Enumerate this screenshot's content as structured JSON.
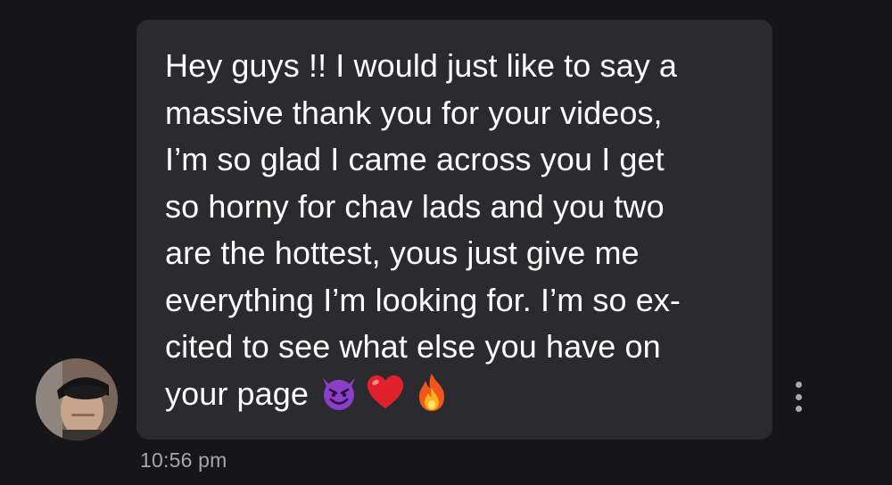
{
  "message": {
    "sender_avatar": "user-avatar",
    "lines": [
      "Hey guys !! I would just like to say a",
      "massive thank you for your videos,",
      "I’m so glad I came across you I get",
      "so horny for chav lads and you two",
      "are the hottest, yous just give me",
      "everything I’m looking for. I’m so ex-",
      "cited to see what else you have on",
      "your page"
    ],
    "emojis": [
      "smiling-devil-icon",
      "red-heart-icon",
      "fire-icon"
    ],
    "timestamp": "10:56 pm"
  },
  "actions": {
    "more_icon": "more-vertical-icon"
  },
  "colors": {
    "background": "#161618",
    "bubble": "#2b2b2f",
    "text": "#ffffff",
    "timestamp": "#a5a6ab"
  }
}
